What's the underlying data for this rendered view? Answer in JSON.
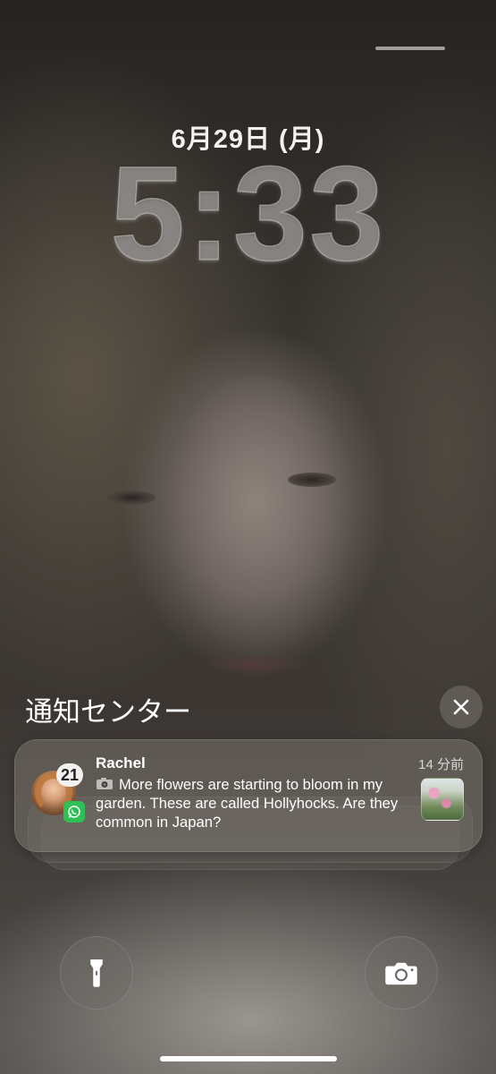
{
  "lockscreen": {
    "date": "6月29日 (月)",
    "time": "5:33"
  },
  "notification_center": {
    "title": "通知センター",
    "close_icon": "close-icon"
  },
  "notification": {
    "app": "WhatsApp",
    "sender": "Rachel",
    "badge_count": "21",
    "timestamp": "14 分前",
    "message": "More flowers are starting to bloom in my garden. These are called Hollyhocks. Are they common in Japan?",
    "message_prefix_icon": "camera-emoji-icon"
  },
  "quick_actions": {
    "left_icon": "flashlight-icon",
    "right_icon": "camera-icon"
  },
  "colors": {
    "whatsapp_green": "#2fc055",
    "text_white": "#ffffff"
  }
}
